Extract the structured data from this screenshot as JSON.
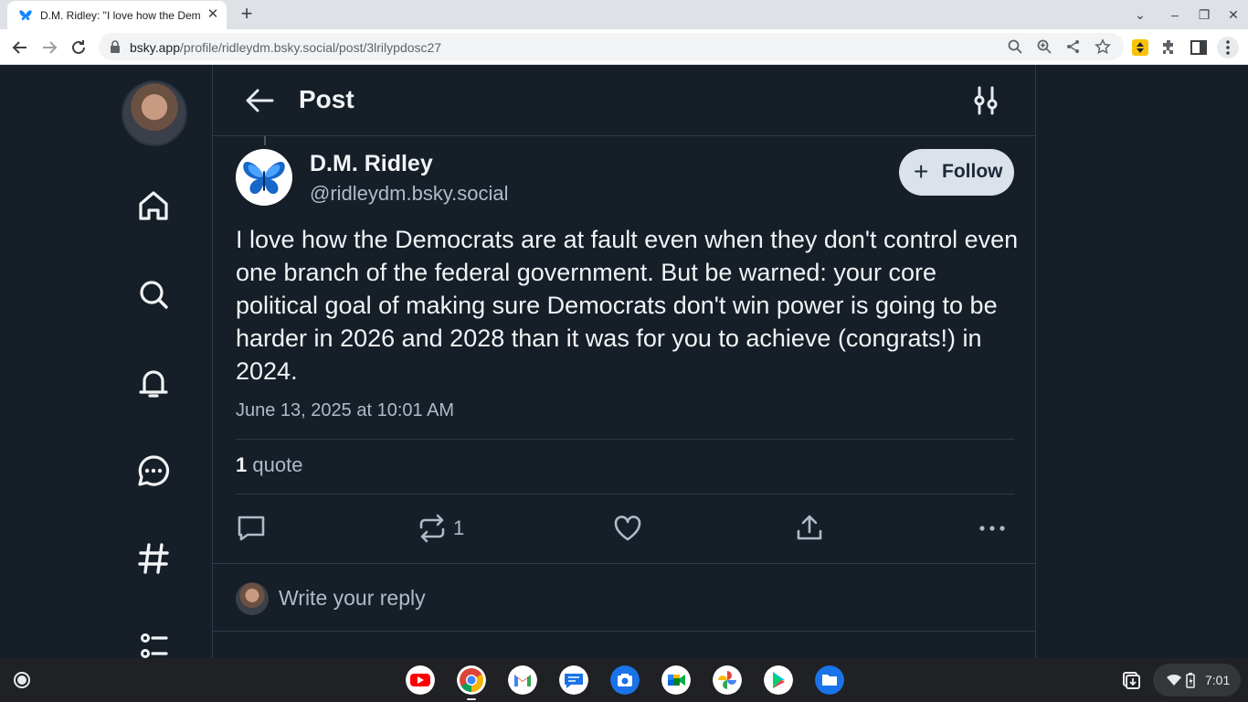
{
  "browser": {
    "tab_title": "D.M. Ridley: \"I love how the Democ",
    "url_host": "bsky.app",
    "url_path": "/profile/ridleydm.bsky.social/post/3lrilypdosc27"
  },
  "page": {
    "header_title": "Post",
    "author": {
      "name": "D.M. Ridley",
      "handle": "@ridleydm.bsky.social"
    },
    "follow_label": "Follow",
    "post_text": "I love how the Democrats are at fault even when they don't control even one branch of the federal government.  But be warned: your core political goal of making sure Democrats don't win power is going to be harder in 2026 and 2028 than it was for you to achieve (congrats!) in 2024.",
    "timestamp": "June 13, 2025 at 10:01 AM",
    "quote_count": "1",
    "quote_label": "quote",
    "repost_count": "1",
    "reply_placeholder": "Write your reply"
  },
  "shelf": {
    "time": "7:01",
    "apps": [
      "youtube-icon",
      "chrome-icon",
      "gmail-icon",
      "messages-icon",
      "camera-icon",
      "meet-icon",
      "photos-icon",
      "play-store-icon",
      "files-icon"
    ]
  },
  "colors": {
    "background": "#161e27",
    "border": "#2e3a48",
    "muted_text": "#aebbc9",
    "follow_button": "#dce2ea"
  }
}
